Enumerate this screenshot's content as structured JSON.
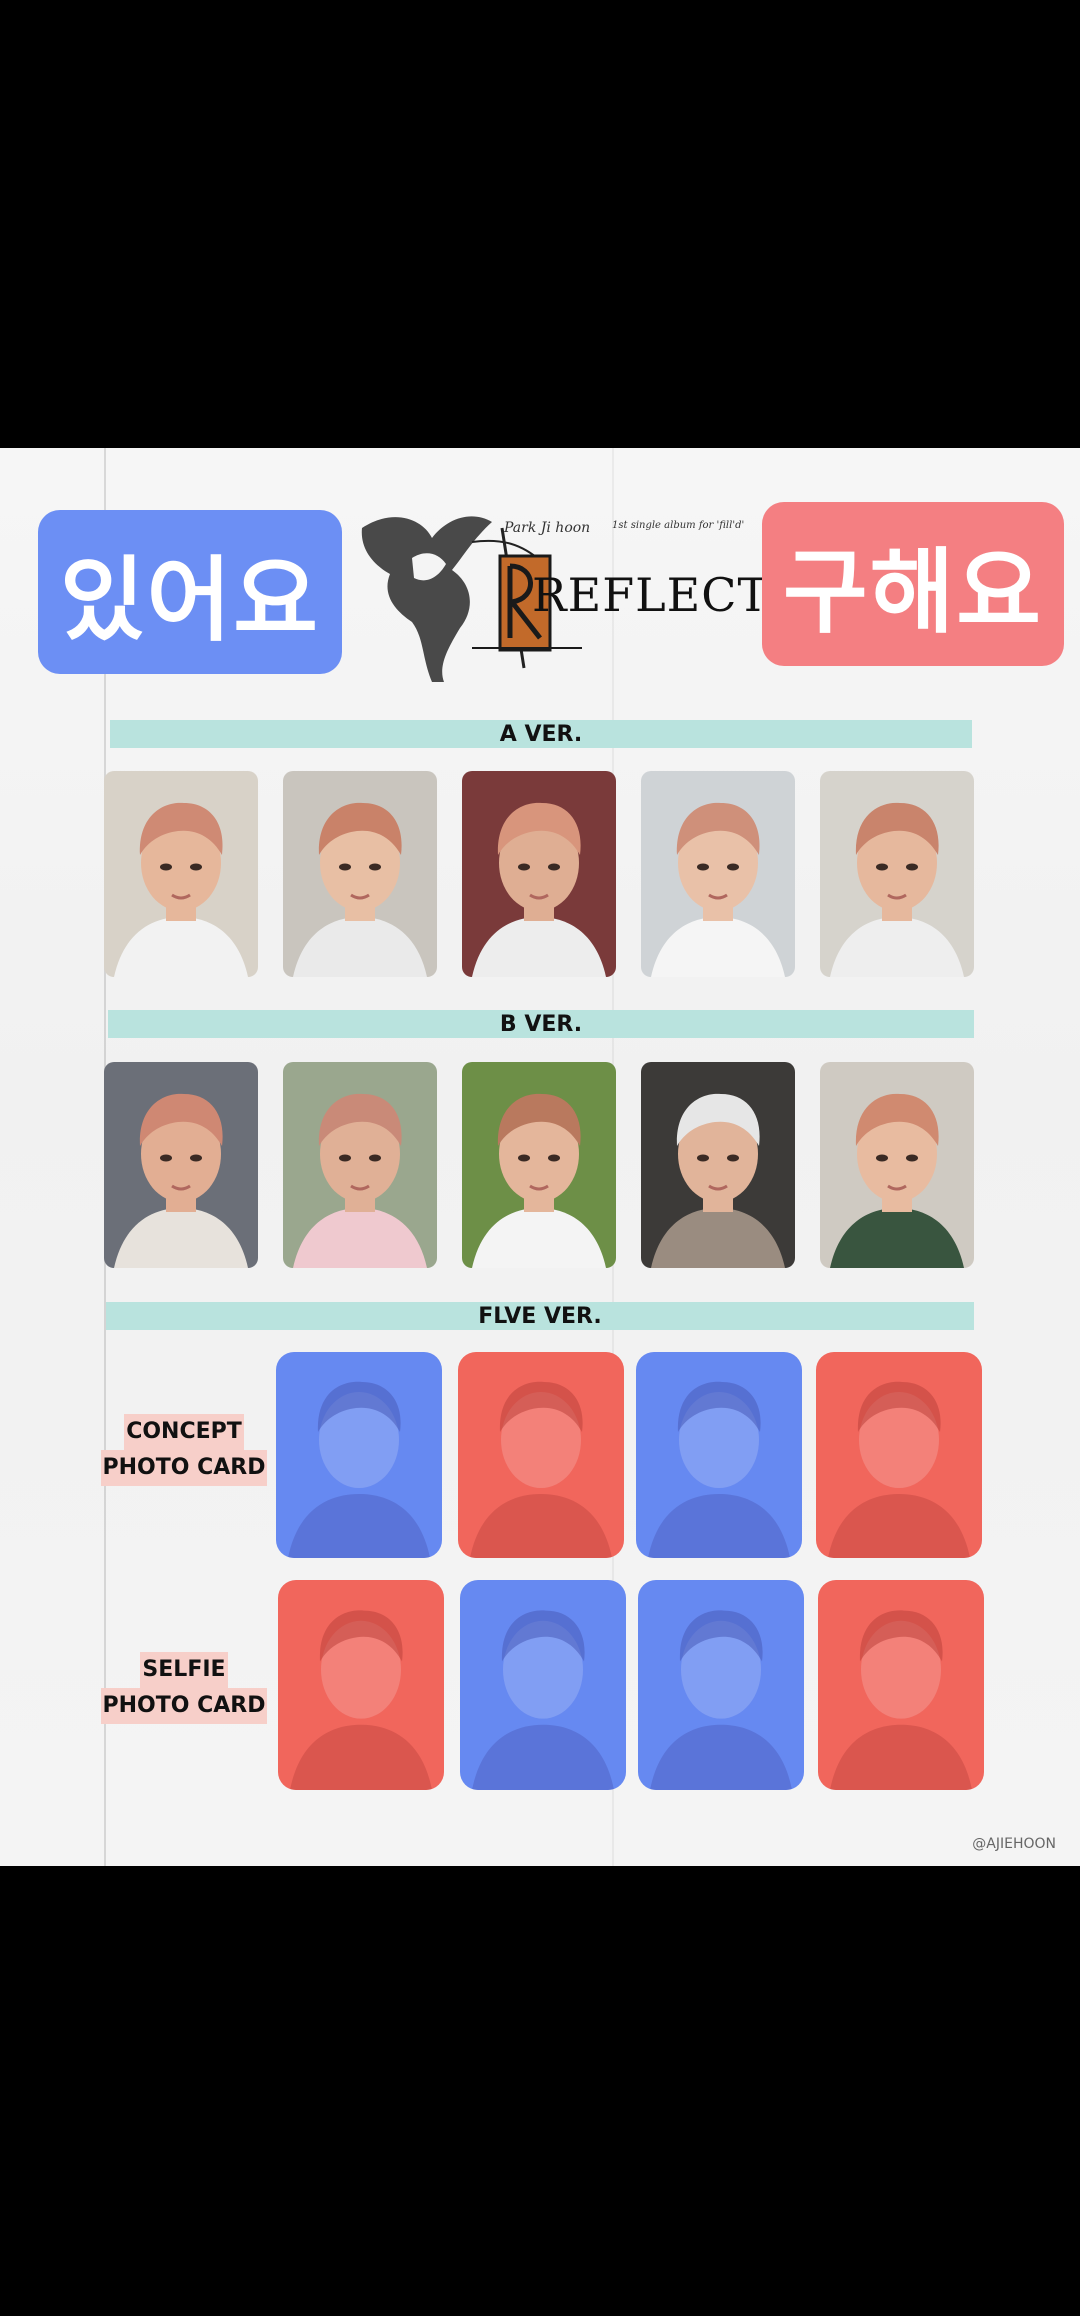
{
  "header": {
    "have_label": "있어요",
    "want_label": "구해요",
    "logo": {
      "artist_text": "Park Ji hoon",
      "album_text": "1st single album for 'fill'd'",
      "wordmark": "REFLECT"
    }
  },
  "sections": {
    "a_ver": "A VER.",
    "b_ver": "B VER.",
    "flve_ver": "FLVE VER."
  },
  "side_labels": {
    "concept_line1": "CONCEPT",
    "concept_line2": "PHOTO CARD",
    "selfie_line1": "SELFIE",
    "selfie_line2": "PHOTO CARD"
  },
  "a_cards": [
    {
      "bg": "#d8d2c8",
      "skin": "#e6b79b",
      "hair": "#cf8a74",
      "shirt": "#f2f2f2"
    },
    {
      "bg": "#c9c5be",
      "skin": "#e8bfa4",
      "hair": "#c98269",
      "shirt": "#eaeaea"
    },
    {
      "bg": "#7a3a3a",
      "skin": "#dfae93",
      "hair": "#d8957c",
      "shirt": "#ededed"
    },
    {
      "bg": "#cfd3d6",
      "skin": "#e9c1a8",
      "hair": "#cf907a",
      "shirt": "#f5f5f5"
    },
    {
      "bg": "#d6d3cc",
      "skin": "#e6b89d",
      "hair": "#c9846c",
      "shirt": "#eeeeee"
    }
  ],
  "b_cards": [
    {
      "bg": "#6b6f78",
      "skin": "#e2ae93",
      "hair": "#cf8873",
      "shirt": "#e7e2dc"
    },
    {
      "bg": "#9aa78e",
      "skin": "#e0b096",
      "hair": "#c98a78",
      "shirt": "#efc9cf"
    },
    {
      "bg": "#6d8f47",
      "skin": "#e4b69b",
      "hair": "#b9795e",
      "shirt": "#f4f4f4"
    },
    {
      "bg": "#3c3a38",
      "skin": "#e1b49a",
      "hair": "#e6e6e6",
      "shirt": "#9a8c80"
    },
    {
      "bg": "#cfcac2",
      "skin": "#e8bba0",
      "hair": "#d08a70",
      "shirt": "#39553f"
    }
  ],
  "concept_cards": [
    "blue",
    "red",
    "blue",
    "red"
  ],
  "selfie_cards": [
    "red",
    "blue",
    "blue",
    "red"
  ],
  "colors": {
    "have": "#6c8ff4",
    "want": "#f47f82",
    "ver_bar": "#b9e3de",
    "tint_blue": "#5a7ff0",
    "tint_red": "#f0594f",
    "label_highlight": "#f7cfc9"
  },
  "credit": "@AJIEHOON"
}
